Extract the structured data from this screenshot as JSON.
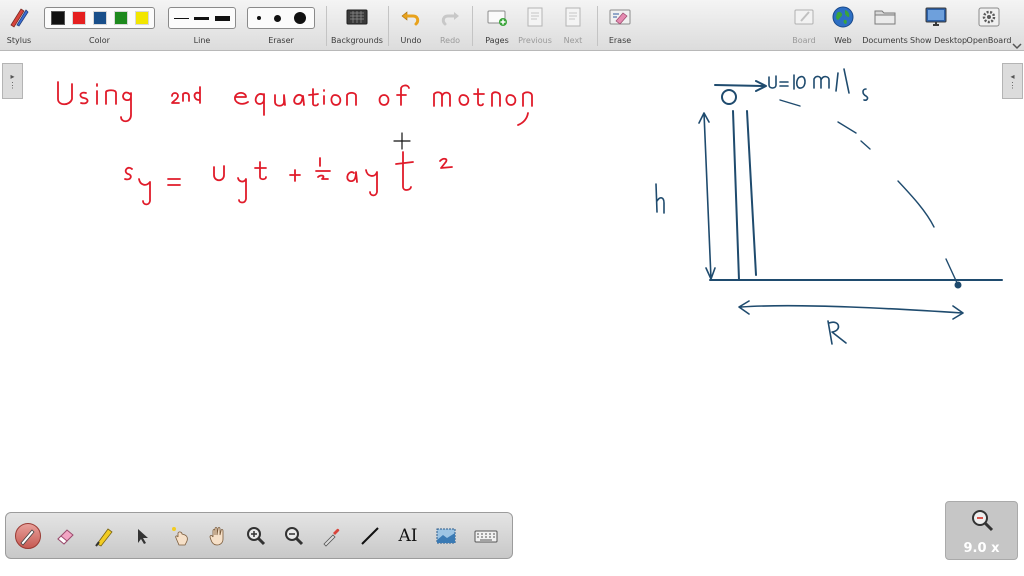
{
  "toolbar": {
    "stylus_label": "Stylus",
    "color_label": "Color",
    "line_label": "Line",
    "eraser_label": "Eraser",
    "backgrounds_label": "Backgrounds",
    "undo_label": "Undo",
    "redo_label": "Redo",
    "pages_label": "Pages",
    "previous_label": "Previous",
    "next_label": "Next",
    "erase_label": "Erase",
    "board_label": "Board",
    "web_label": "Web",
    "documents_label": "Documents",
    "show_desktop_label": "Show Desktop",
    "openboard_label": "OpenBoard"
  },
  "colors": {
    "swatches": [
      "#111111",
      "#e52020",
      "#1a4f8a",
      "#1e8a1e",
      "#f2e600"
    ],
    "ink_red": "#e01b2a",
    "ink_blue": "#1f4b6e"
  },
  "bottom_tools": [
    "pen-icon",
    "eraser-icon",
    "highlighter-icon",
    "pointer-icon",
    "laser-icon",
    "hand-icon",
    "zoom-in-icon",
    "zoom-out-icon",
    "picker-icon",
    "line-icon",
    "text-icon",
    "capture-icon",
    "keyboard-icon"
  ],
  "bottom_text_tool_glyph": "AI",
  "zoom": {
    "value": "9.0 x"
  },
  "board": {
    "line1": "Using 2nd equation of motion,",
    "line2": "sy = uy t + 1/2 ay t²",
    "diagram_velocity": "u = 10 m/s",
    "diagram_height": "h",
    "diagram_range": "R"
  }
}
